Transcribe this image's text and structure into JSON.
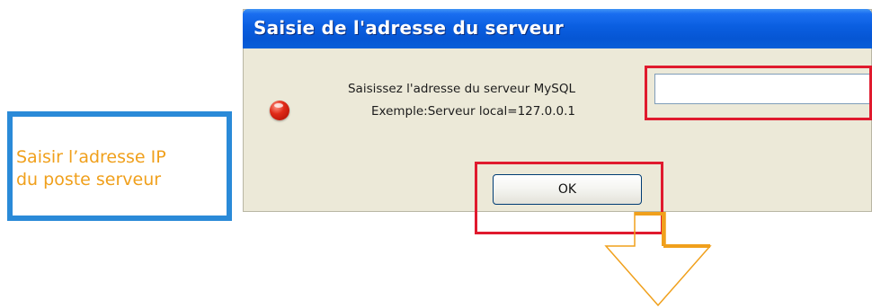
{
  "dialog": {
    "title": "Saisie de l'adresse du serveur",
    "message_line_1": "Saisissez l'adresse du serveur MySQL",
    "message_line_2": "Exemple:Serveur local=127.0.0.1",
    "address_input": {
      "value": "",
      "placeholder": ""
    },
    "ok_label": "OK",
    "icon": "info-icon"
  },
  "annotation": {
    "line_1": "Saisir l’adresse IP",
    "line_2": "du poste serveur"
  },
  "colors": {
    "annotation_text": "#f0a01c",
    "annotation_border": "#2a8ad8",
    "highlight": "#e01a2e",
    "arrow": "#f0a01c",
    "titlebar": "#0a5ee0"
  }
}
